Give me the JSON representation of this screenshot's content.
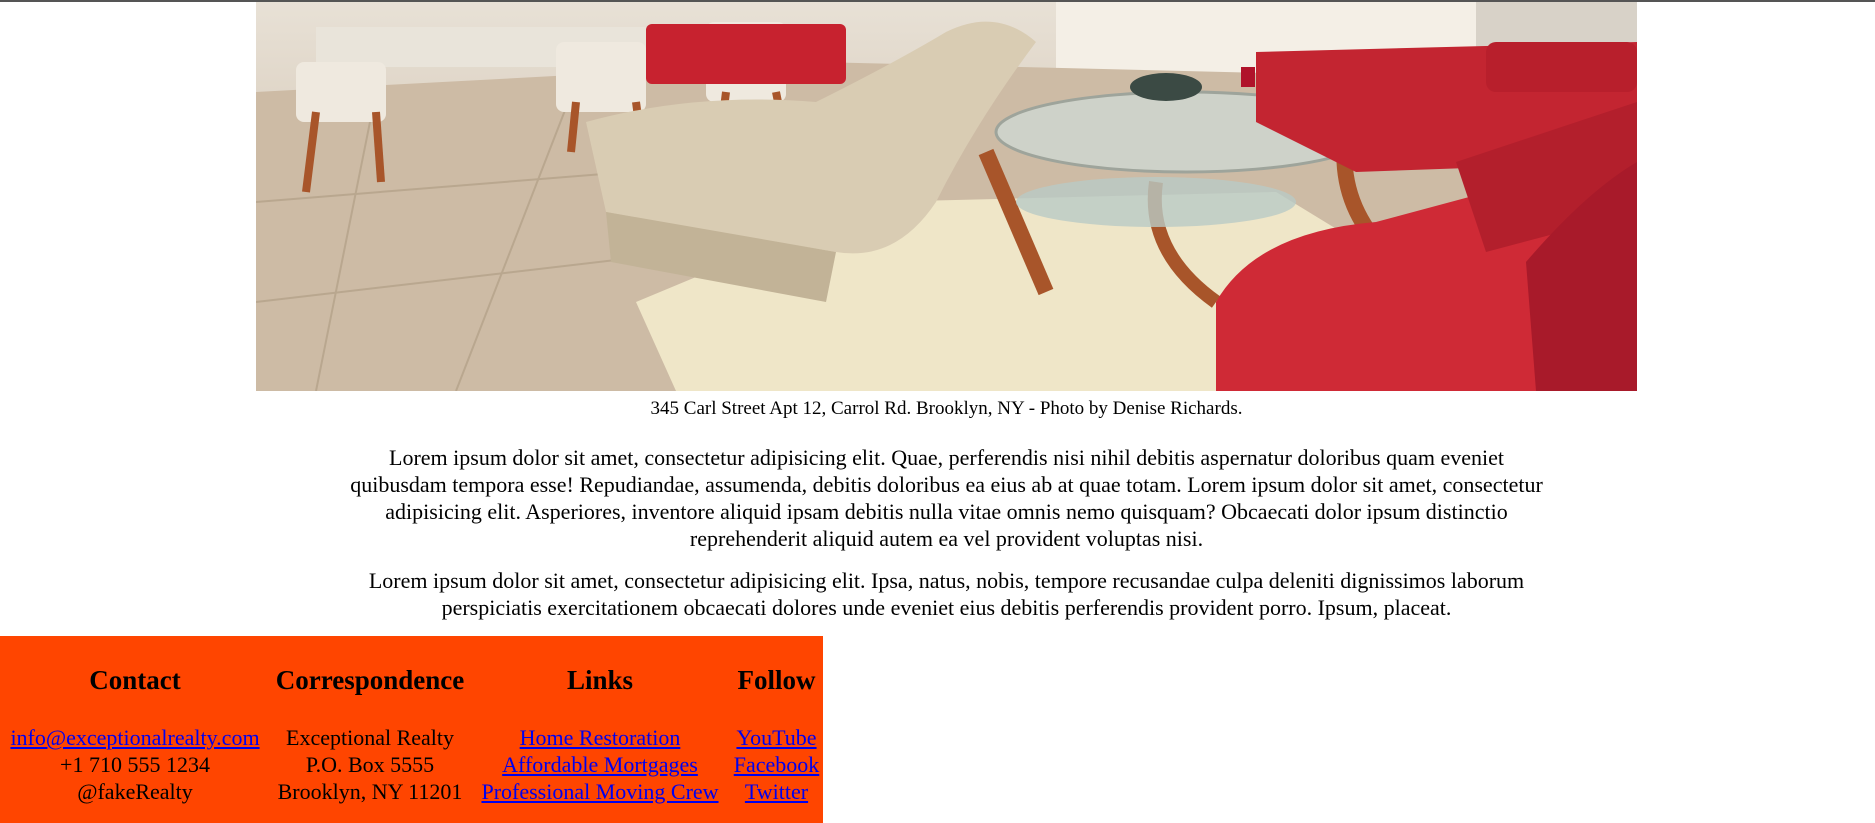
{
  "hero": {
    "icon": "living-room-photo",
    "caption": "345 Carl Street Apt 12, Carrol Rd. Brooklyn, NY - Photo by Denise Richards."
  },
  "content": {
    "paragraph_1": "Lorem ipsum dolor sit amet, consectetur adipisicing elit. Quae, perferendis nisi nihil debitis aspernatur doloribus quam eveniet quibusdam tempora esse! Repudiandae, assumenda, debitis doloribus ea eius ab at quae totam. Lorem ipsum dolor sit amet, consectetur adipisicing elit. Asperiores, inventore aliquid ipsam debitis nulla vitae omnis nemo quisquam? Obcaecati dolor ipsum distinctio reprehenderit aliquid autem ea vel provident voluptas nisi.",
    "paragraph_2": "Lorem ipsum dolor sit amet, consectetur adipisicing elit. Ipsa, natus, nobis, tempore recusandae culpa deleniti dignissimos laborum perspiciatis exercitationem obcaecati dolores unde eveniet eius debitis perferendis provident porro. Ipsum, placeat."
  },
  "footer": {
    "background": "#ff4500",
    "link_color": "#0000ee",
    "contact": {
      "heading": "Contact",
      "email": "info@exceptionalrealty.com",
      "phone": "+1 710 555 1234",
      "handle": "@fakeRealty"
    },
    "correspondence": {
      "heading": "Correspondence",
      "line_1": "Exceptional Realty",
      "line_2": "P.O. Box 5555",
      "line_3": "Brooklyn, NY 11201"
    },
    "links": {
      "heading": "Links",
      "items": [
        "Home Restoration",
        "Affordable Mortgages",
        "Professional Moving Crew"
      ]
    },
    "follow": {
      "heading": "Follow",
      "items": [
        "YouTube",
        "Facebook",
        "Twitter"
      ]
    }
  }
}
